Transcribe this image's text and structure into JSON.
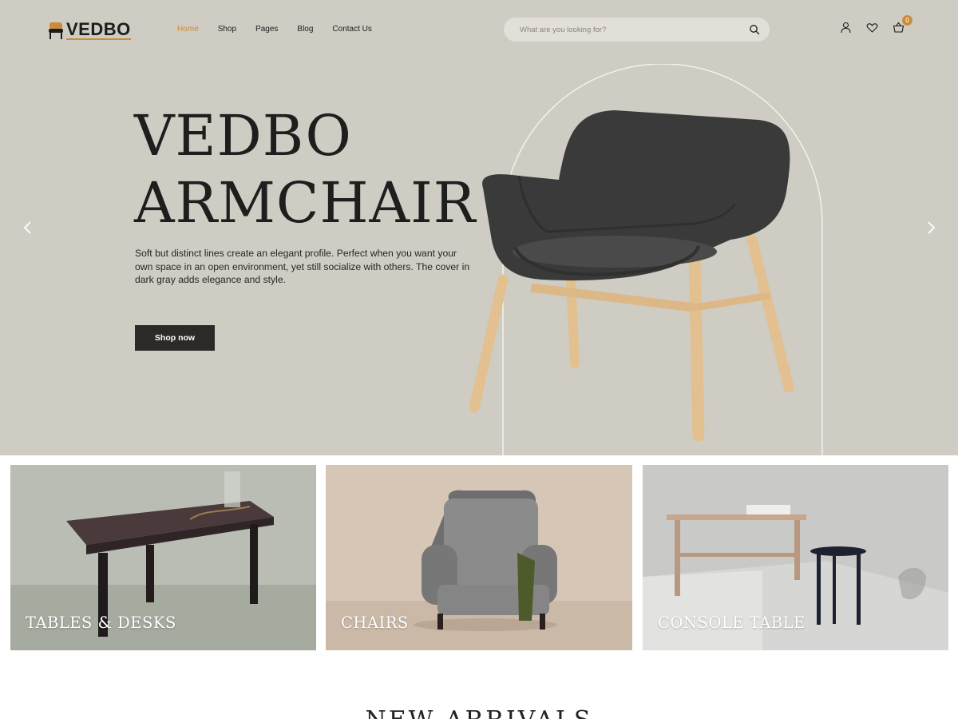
{
  "brand": {
    "name": "VEDBO",
    "accent_color": "#c98c3e"
  },
  "nav": {
    "items": [
      {
        "label": "Home",
        "active": true
      },
      {
        "label": "Shop",
        "active": false
      },
      {
        "label": "Pages",
        "active": false
      },
      {
        "label": "Blog",
        "active": false
      },
      {
        "label": "Contact Us",
        "active": false
      }
    ]
  },
  "search": {
    "placeholder": "What are you looking for?",
    "value": "",
    "icon": "search-icon"
  },
  "header_icons": {
    "account": "user-icon",
    "wishlist": "heart-icon",
    "cart": "basket-icon",
    "cart_count": "0"
  },
  "hero": {
    "title_line1": "VEDBO",
    "title_line2": "ARMCHAIR",
    "description": "Soft but distinct lines create an elegant profile. Perfect when you want your own space in an open environment, yet still socialize with others. The cover in dark gray adds elegance and style.",
    "cta_label": "Shop now",
    "prev_icon": "chevron-left-icon",
    "next_icon": "chevron-right-icon",
    "background_color": "#cfccc3"
  },
  "categories": [
    {
      "label": "TABLES & DESKS"
    },
    {
      "label": "CHAIRS"
    },
    {
      "label": "CONSOLE TABLE"
    }
  ],
  "section": {
    "title": "NEW ARRIVALS"
  }
}
